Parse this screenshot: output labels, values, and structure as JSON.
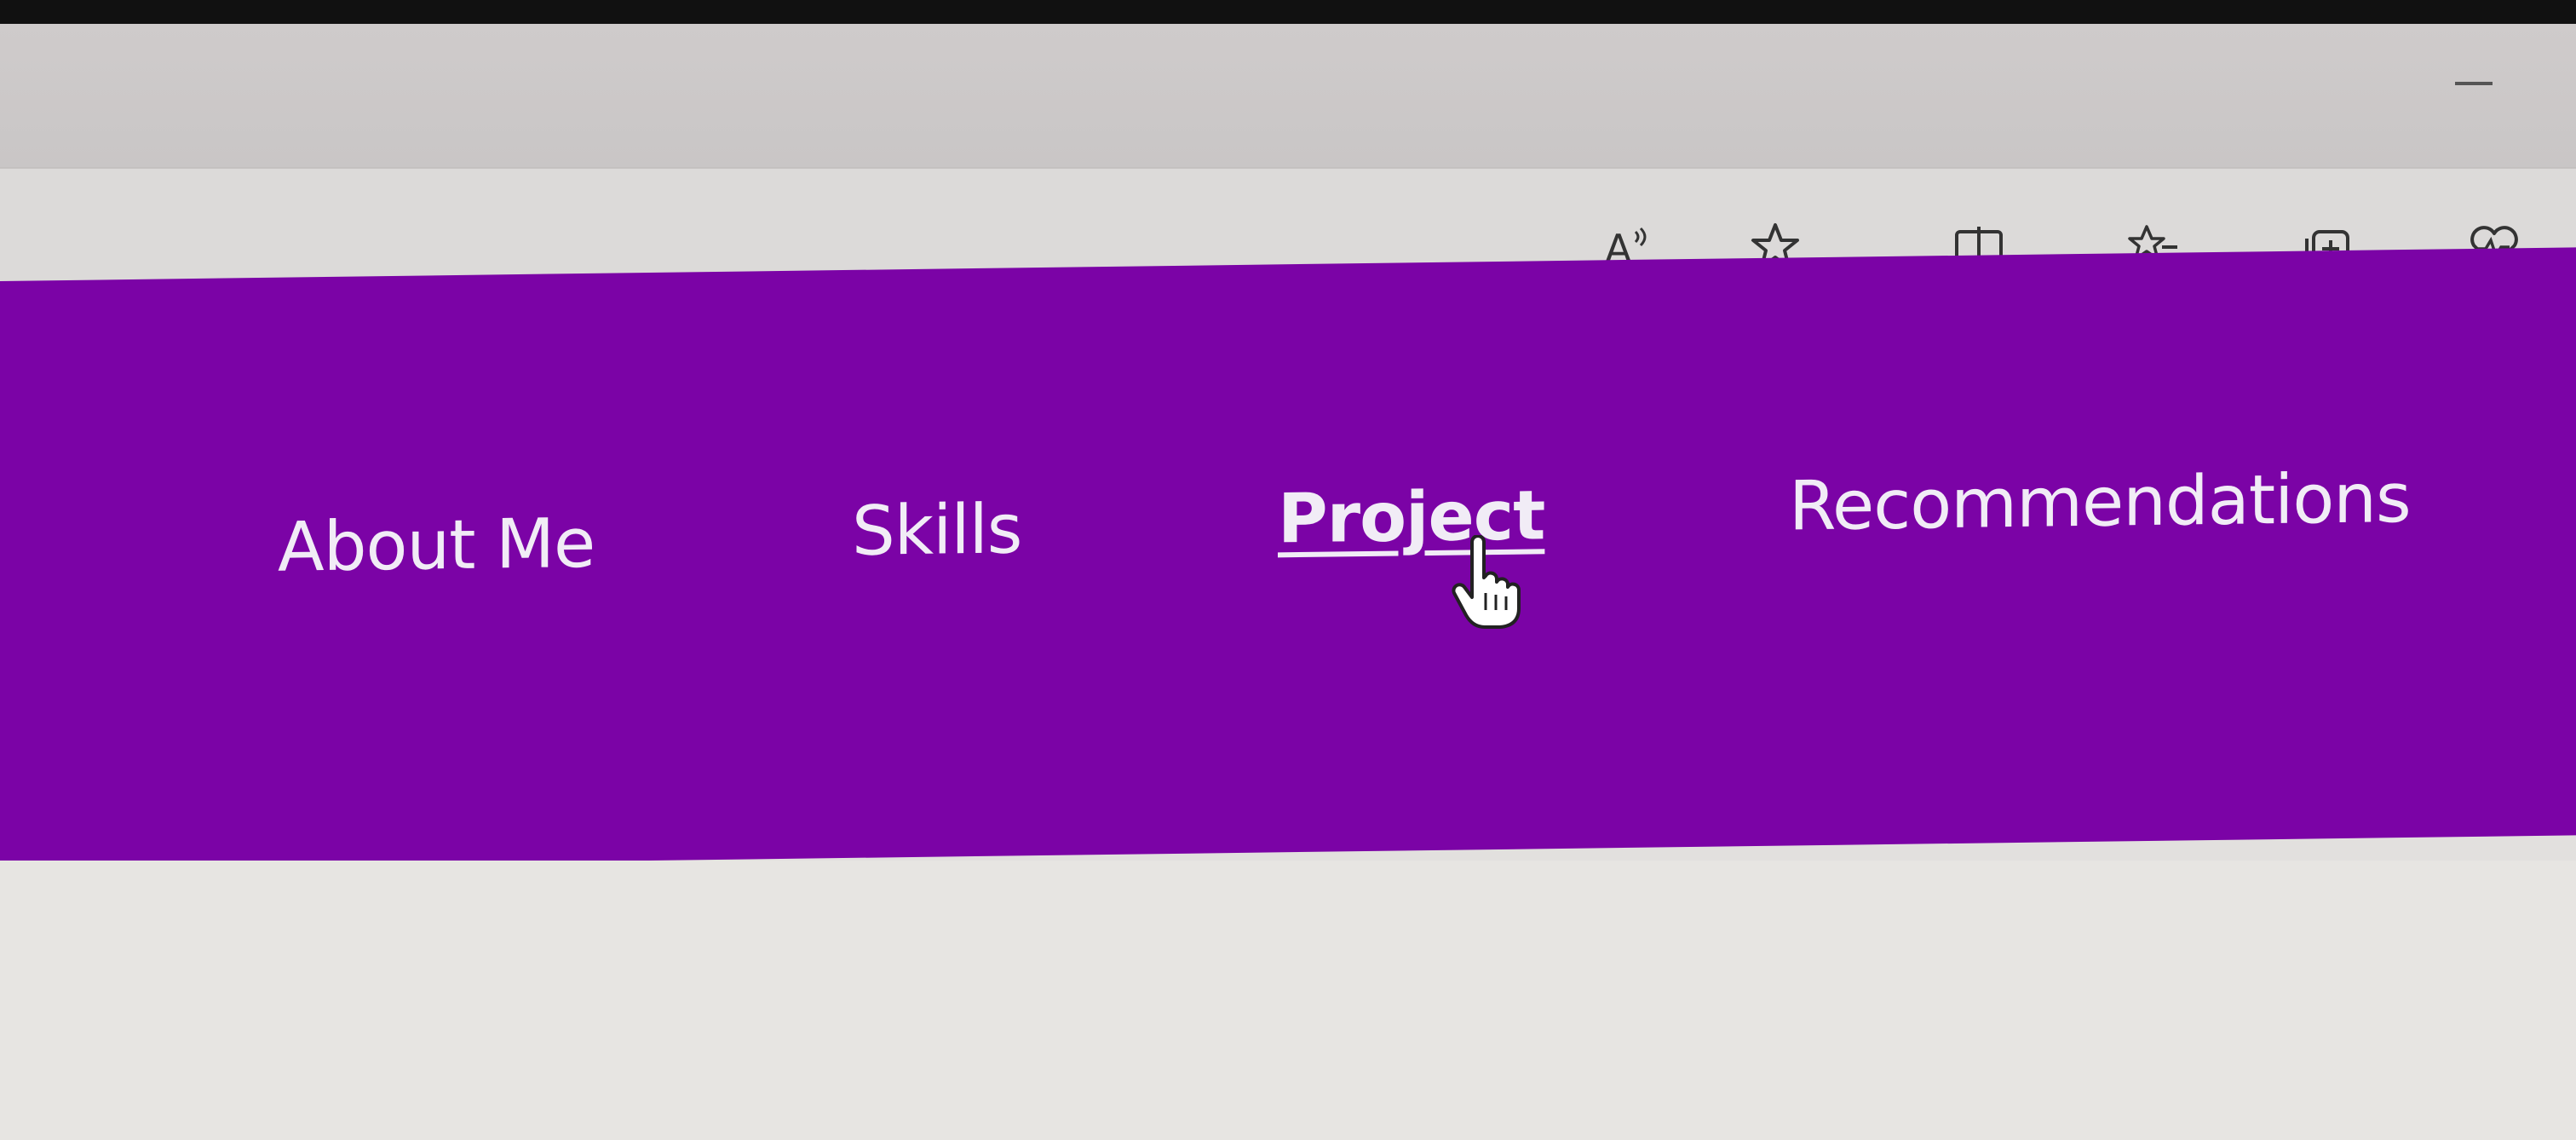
{
  "browser": {
    "window_controls": {
      "minimize_icon": "minimize-icon"
    },
    "toolbar": {
      "icons": [
        {
          "name": "read-aloud-icon",
          "label": "A"
        },
        {
          "name": "favorite-star-icon"
        },
        {
          "name": "split-screen-icon"
        },
        {
          "name": "favorites-list-icon"
        },
        {
          "name": "collections-icon"
        },
        {
          "name": "browser-essentials-icon"
        }
      ]
    }
  },
  "site": {
    "nav_color": "#7b03a6",
    "nav_text_color": "#f1ecf6",
    "nav": {
      "about": "About Me",
      "skills": "Skills",
      "project": "Project",
      "recommendations": "Recommendations"
    },
    "active_item": "Project",
    "cursor_icon": "hand-pointer-icon"
  }
}
